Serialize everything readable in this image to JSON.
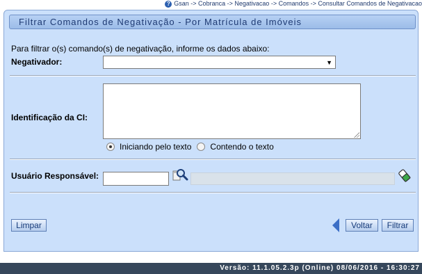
{
  "breadcrumb": {
    "text": "Gsan -> Cobranca -> Negativacao -> Comandos -> Consultar Comandos de Negativacao"
  },
  "title": "Filtrar Comandos de Negativação - Por Matrícula de Imóveis",
  "instruction": "Para filtrar o(s) comando(s) de negativação, informe os dados abaixo:",
  "fields": {
    "negativador_label": "Negativador:",
    "negativador_value": "",
    "identificacao_label": "Identificação da CI:",
    "identificacao_value": "",
    "radio_iniciando": "Iniciando pelo texto",
    "radio_contendo": "Contendo o texto",
    "usuario_label": "Usuário Responsável:",
    "usuario_value": "",
    "usuario_nome_value": ""
  },
  "buttons": {
    "limpar": "Limpar",
    "voltar": "Voltar",
    "filtrar": "Filtrar"
  },
  "footer": {
    "version": "Versão: 11.1.05.2.3p (Online) 08/06/2016 - 16:30:27"
  },
  "icons": {
    "help": "help-icon",
    "search": "search-icon",
    "eraser": "eraser-icon",
    "back": "back-arrow-icon"
  }
}
